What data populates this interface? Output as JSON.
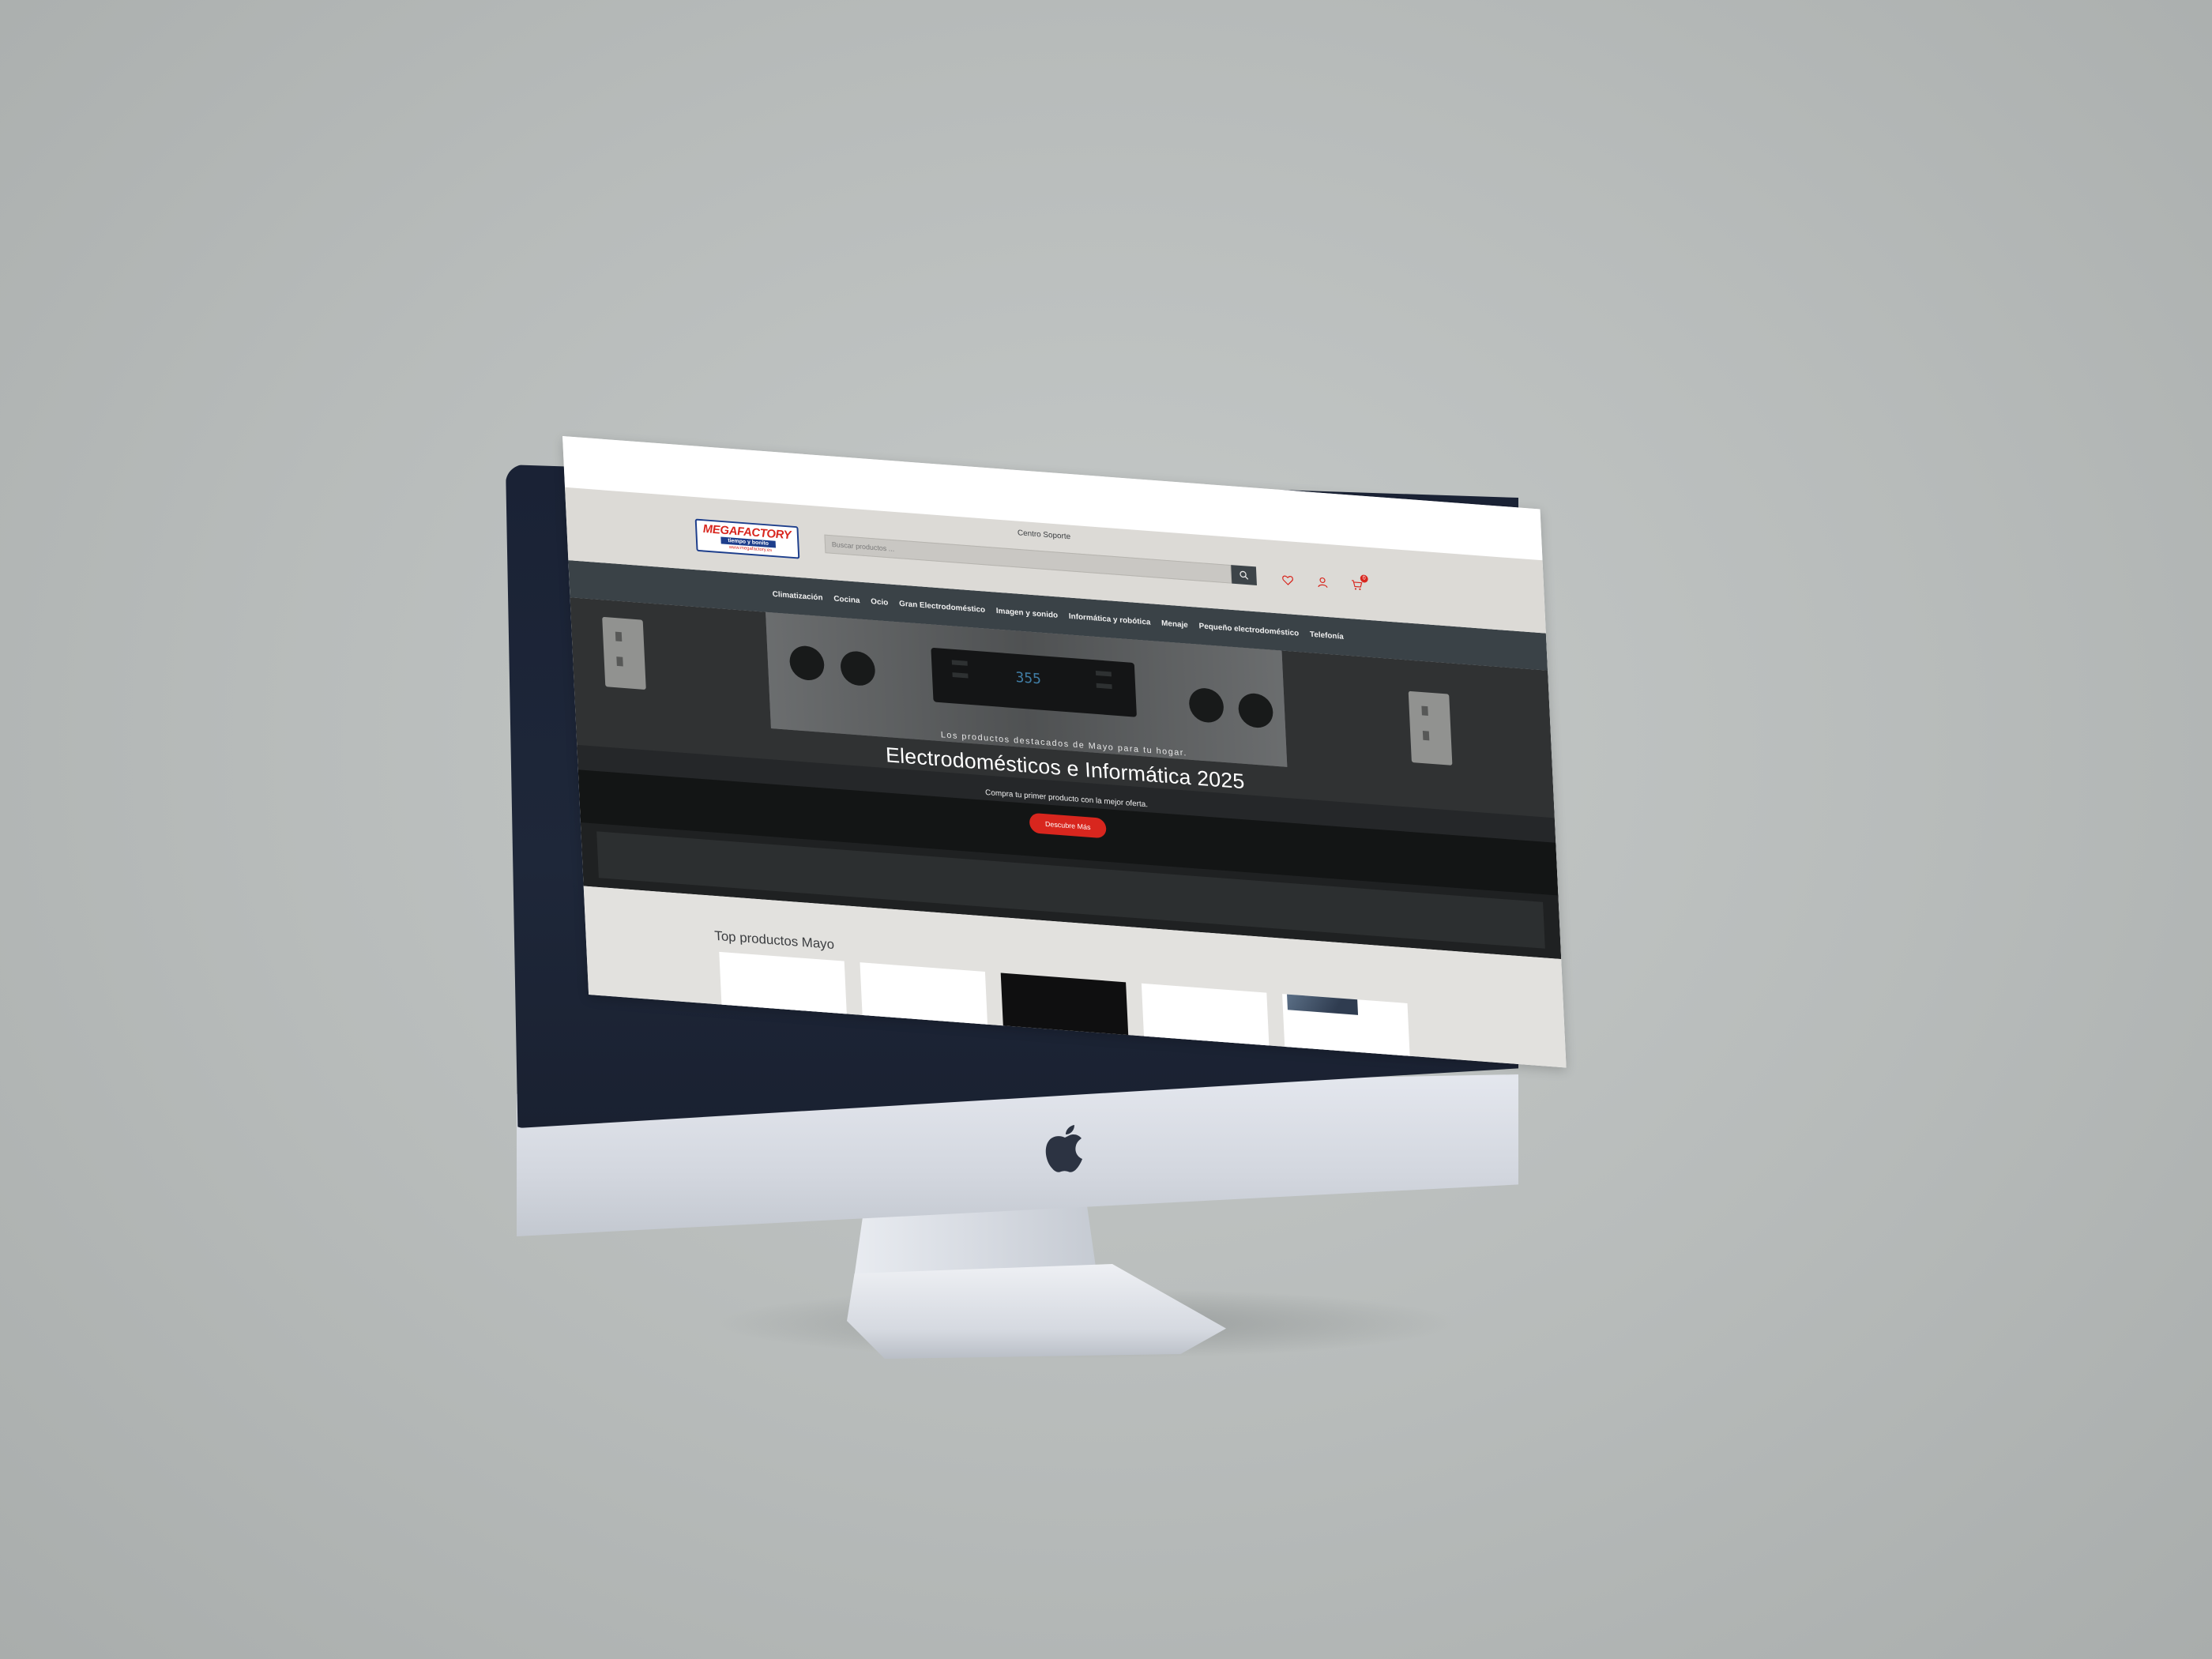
{
  "header": {
    "logo": {
      "name": "MEGAFACTORY",
      "tagline": "tiempo y bonito",
      "url": "www.megafactory.es"
    },
    "support_link": "Centro Soporte",
    "search": {
      "placeholder": "Buscar productos ...",
      "value": ""
    },
    "icons": [
      "heart-icon",
      "user-icon",
      "cart-icon"
    ],
    "cart_count": "0"
  },
  "nav": {
    "items": [
      "Climatización",
      "Cocina",
      "Ocio",
      "Gran Electrodoméstico",
      "Imagen y sonido",
      "Informática y robótica",
      "Menaje",
      "Pequeño electrodoméstico",
      "Telefonía"
    ]
  },
  "hero": {
    "eyebrow": "Los productos destacados de Mayo para tu hogar.",
    "title": "Electrodomésticos e Informática 2025",
    "subtitle": "Compra tu primer producto con la mejor oferta.",
    "button": "Descubre Más",
    "display_readout": "355"
  },
  "products": {
    "title": "Top productos Mayo"
  },
  "colors": {
    "accent": "#d8261e",
    "nav_bg": "#3a4247",
    "header_bg": "#dcdad6",
    "brand_blue": "#1d3e8c"
  }
}
